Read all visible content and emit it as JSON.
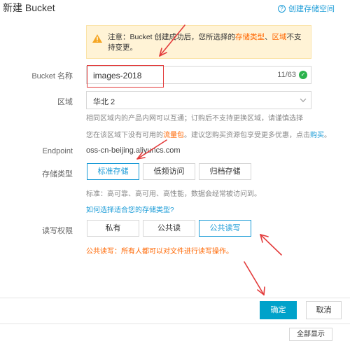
{
  "dialog": {
    "title": "新建 Bucket",
    "help_link": "创建存储空间",
    "help_icon": "question-circle-icon"
  },
  "notice": {
    "icon": "warning-icon",
    "prefix": "注意：Bucket 创建成功后，您所选择的",
    "storage_type_link": "存储类型",
    "separator": "、",
    "region_link": "区域",
    "suffix": "不支持变更。",
    "bg_color": "#fff3d6"
  },
  "bucket_name": {
    "label": "Bucket 名称",
    "value": "images-2018",
    "counter": "11/63",
    "valid_icon": "check-circle-icon"
  },
  "region": {
    "label": "区域",
    "selected": "华北 2",
    "hint": "相同区域内的产品内网可以互通；订购后不支持更换区域，请谨慎选择",
    "pkg_prefix": "您在该区域下没有可用的",
    "pkg_link": "流量包",
    "pkg_middle": "。建议您购买资源包享受更多优惠，点击",
    "buy_link": "购买",
    "pkg_suffix": "。"
  },
  "endpoint": {
    "label": "Endpoint",
    "value": "oss-cn-beijing.aliyuncs.com"
  },
  "storage_type": {
    "label": "存储类型",
    "options": [
      "标准存储",
      "低频访问",
      "归档存储"
    ],
    "selected": "标准存储",
    "hint": "标准：高可靠、高可用、高性能，数据会经常被访问到。",
    "help_link": "如何选择适合您的存储类型?"
  },
  "acl": {
    "label": "读写权限",
    "options": [
      "私有",
      "公共读",
      "公共读写"
    ],
    "selected": "公共读写",
    "warning": "公共读写：所有人都可以对文件进行读写操作。"
  },
  "footer": {
    "confirm": "确定",
    "cancel": "取消",
    "bottom_button": "全部显示"
  },
  "colors": {
    "accent": "#1a9bd7",
    "primary_button": "#00a2ca",
    "warning_text": "#ff6600",
    "annotation": "#e33b3b"
  }
}
